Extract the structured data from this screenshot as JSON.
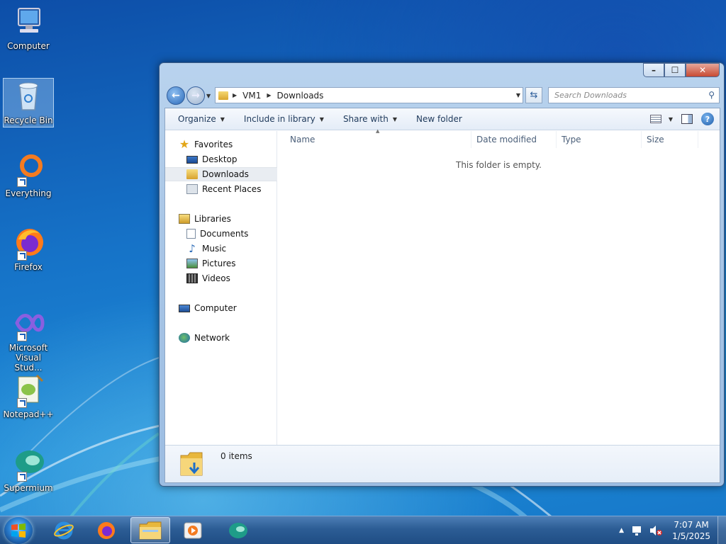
{
  "desktop": {
    "icons": [
      {
        "label": "Computer",
        "icon": "computer-icon"
      },
      {
        "label": "Recycle Bin",
        "icon": "recycle-bin-icon"
      },
      {
        "label": "Everything",
        "icon": "everything-icon"
      },
      {
        "label": "Firefox",
        "icon": "firefox-icon"
      },
      {
        "label": "Microsoft Visual Stud...",
        "icon": "visual-studio-icon"
      },
      {
        "label": "Notepad++",
        "icon": "notepad-plus-plus-icon"
      },
      {
        "label": "Supermium",
        "icon": "supermium-icon"
      }
    ]
  },
  "window": {
    "controls": {
      "minimize": "–",
      "maximize": "☐",
      "close": "✕"
    },
    "address": {
      "crumbs": [
        "VM1",
        "Downloads"
      ]
    },
    "search": {
      "placeholder": "Search Downloads"
    },
    "toolbar": {
      "organize": "Organize",
      "include_in_library": "Include in library",
      "share_with": "Share with",
      "new_folder": "New folder",
      "help": "?"
    },
    "nav": {
      "favorites": "Favorites",
      "favorites_items": [
        "Desktop",
        "Downloads",
        "Recent Places"
      ],
      "libraries": "Libraries",
      "libraries_items": [
        "Documents",
        "Music",
        "Pictures",
        "Videos"
      ],
      "computer": "Computer",
      "network": "Network",
      "selected": "Downloads"
    },
    "columns": [
      "Name",
      "Date modified",
      "Type",
      "Size"
    ],
    "empty_message": "This folder is empty.",
    "details": {
      "item_count": "0 items"
    }
  },
  "taskbar": {
    "pinned": [
      "start-button",
      "internet-explorer-icon",
      "firefox-icon",
      "windows-explorer-icon",
      "media-player-icon",
      "supermium-icon"
    ],
    "clock": {
      "time": "7:07 AM",
      "date": "1/5/2025"
    }
  },
  "colors": {
    "accent": "#1f5ca8",
    "window_frame": "#a9c6e6",
    "close_button": "#c84a33",
    "taskbar": "#2c5d95"
  }
}
